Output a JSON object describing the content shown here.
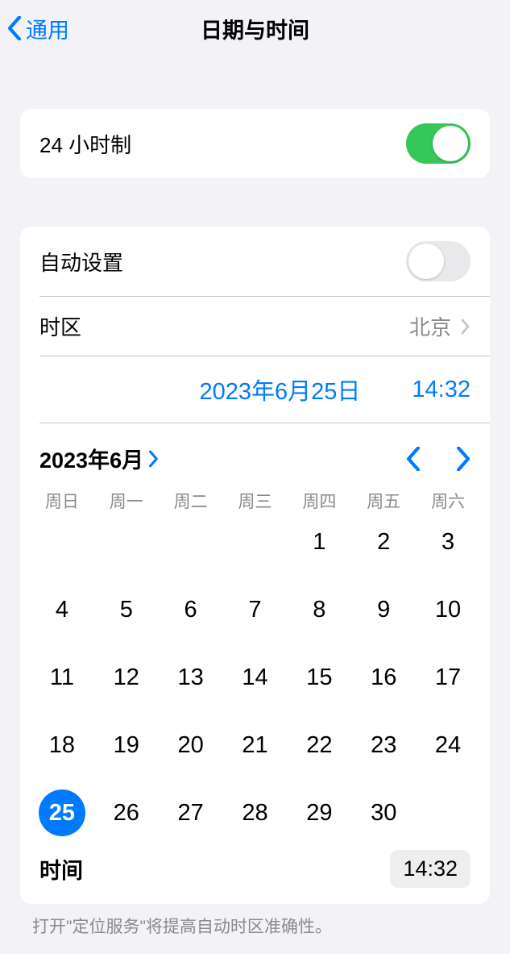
{
  "header": {
    "back_label": "通用",
    "title": "日期与时间"
  },
  "rows": {
    "hour24": {
      "label": "24 小时制",
      "enabled": true
    },
    "autoset": {
      "label": "自动设置",
      "enabled": false
    },
    "timezone": {
      "label": "时区",
      "value": "北京"
    }
  },
  "current": {
    "date_display": "2023年6月25日",
    "time_display": "14:32"
  },
  "calendar": {
    "month_label": "2023年6月",
    "weekdays": [
      "周日",
      "周一",
      "周二",
      "周三",
      "周四",
      "周五",
      "周六"
    ],
    "leading_blanks": 4,
    "days_in_month": 30,
    "selected_day": 25,
    "time_label": "时间",
    "time_value": "14:32"
  },
  "footer": {
    "note": "打开\"定位服务\"将提高自动时区准确性。"
  },
  "colors": {
    "accent": "#007aff",
    "toggle_on": "#34c759"
  }
}
